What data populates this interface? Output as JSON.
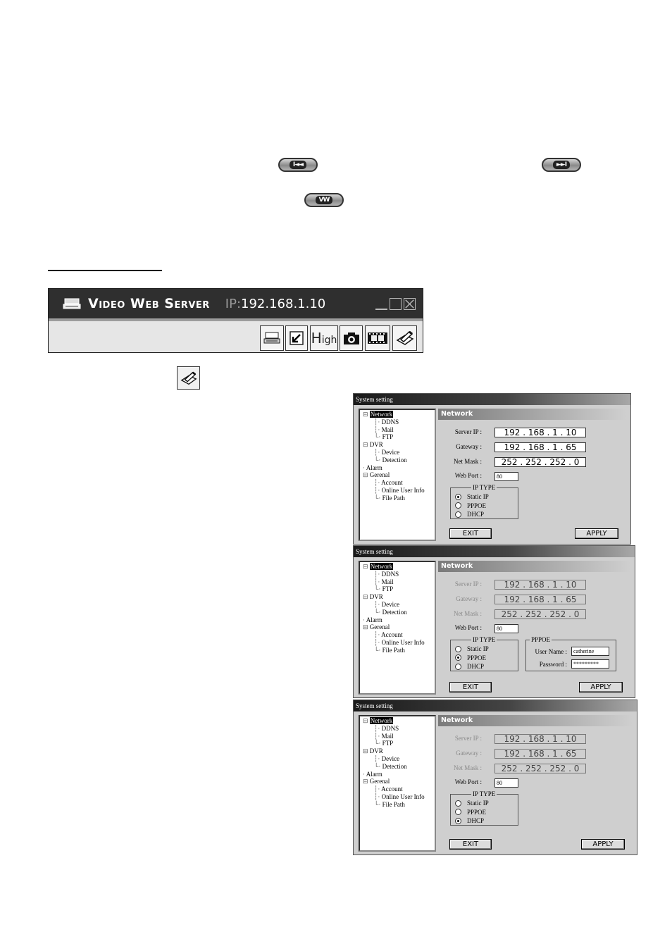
{
  "nav_buttons": {
    "prev_label": "I◄◄",
    "next_label": "►►I",
    "view_label": "VW"
  },
  "app": {
    "title": "Video Web Server",
    "ip_label": "IP:",
    "ip_value": "192.168.1.10",
    "toolbar": {
      "quality_label": "High"
    }
  },
  "dialog": {
    "title": "System setting",
    "tree": [
      "Network",
      "DDNS",
      "Mail",
      "FTP",
      "DVR",
      "Device",
      "Detection",
      "Alarm",
      "Gerenal",
      "Account",
      "Online User Info",
      "File Path"
    ],
    "section": "Network",
    "labels": {
      "server_ip": "Server IP :",
      "gateway": "Gateway :",
      "net_mask": "Net Mask :",
      "web_port": "Web Port :"
    },
    "values": {
      "server_ip": "192 . 168 . 1 . 10",
      "gateway": "192 . 168 . 1 . 65",
      "net_mask": "252 . 252 . 252 . 0",
      "web_port": "80"
    },
    "ip_type": {
      "legend": "IP TYPE",
      "options": [
        "Static IP",
        "PPPOE",
        "DHCP"
      ]
    },
    "pppoe": {
      "legend": "PPPOE",
      "user_label": "User Name :",
      "password_label": "Password :",
      "user_value": "catherine",
      "password_value": "*********"
    },
    "exit_label": "EXIT",
    "apply_label": "APPLY"
  },
  "dialogs_selected": [
    "Static IP",
    "PPPOE",
    "DHCP"
  ]
}
